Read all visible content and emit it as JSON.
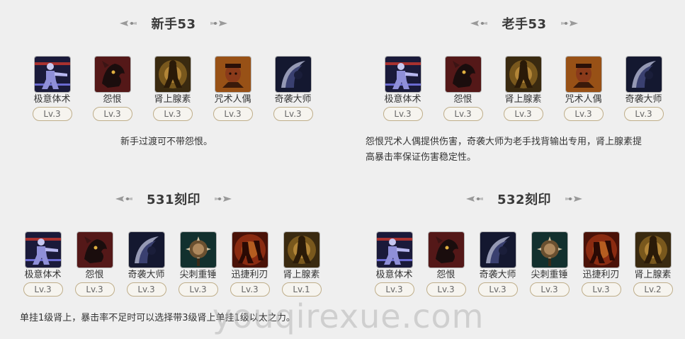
{
  "sections": {
    "newbie": {
      "title": "新手53",
      "skills": [
        {
          "name": "极意体术",
          "level": "Lv.3",
          "icon": "martial-arts-icon"
        },
        {
          "name": "怨恨",
          "level": "Lv.3",
          "icon": "grudge-icon"
        },
        {
          "name": "肾上腺素",
          "level": "Lv.3",
          "icon": "adrenaline-icon"
        },
        {
          "name": "咒术人偶",
          "level": "Lv.3",
          "icon": "curse-doll-icon"
        },
        {
          "name": "奇袭大师",
          "level": "Lv.3",
          "icon": "ambush-master-icon"
        }
      ],
      "description": "新手过渡可不带怨恨。"
    },
    "veteran": {
      "title": "老手53",
      "skills": [
        {
          "name": "极意体术",
          "level": "Lv.3",
          "icon": "martial-arts-icon"
        },
        {
          "name": "怨恨",
          "level": "Lv.3",
          "icon": "grudge-icon"
        },
        {
          "name": "肾上腺素",
          "level": "Lv.3",
          "icon": "adrenaline-icon"
        },
        {
          "name": "咒术人偶",
          "level": "Lv.3",
          "icon": "curse-doll-icon"
        },
        {
          "name": "奇袭大师",
          "level": "Lv.3",
          "icon": "ambush-master-icon"
        }
      ],
      "description_line1": "怨恨咒术人偶提供伤害，奇袭大师为老手找背输出专用，肾上腺素提",
      "description_line2": "高暴击率保证伤害稳定性。"
    },
    "build531": {
      "title": "531刻印",
      "skills": [
        {
          "name": "极意体术",
          "level": "Lv.3",
          "icon": "martial-arts-icon"
        },
        {
          "name": "怨恨",
          "level": "Lv.3",
          "icon": "grudge-icon"
        },
        {
          "name": "奇袭大师",
          "level": "Lv.3",
          "icon": "ambush-master-icon"
        },
        {
          "name": "尖刺重锤",
          "level": "Lv.3",
          "icon": "spiked-hammer-icon"
        },
        {
          "name": "迅捷利刃",
          "level": "Lv.3",
          "icon": "swift-blade-icon"
        },
        {
          "name": "肾上腺素",
          "level": "Lv.1",
          "icon": "adrenaline-icon"
        }
      ],
      "description": "单挂1级肾上，暴击率不足时可以选择带3级肾上单挂1级以太之力。"
    },
    "build532": {
      "title": "532刻印",
      "skills": [
        {
          "name": "极意体术",
          "level": "Lv.3",
          "icon": "martial-arts-icon"
        },
        {
          "name": "怨恨",
          "level": "Lv.3",
          "icon": "grudge-icon"
        },
        {
          "name": "奇袭大师",
          "level": "Lv.3",
          "icon": "ambush-master-icon"
        },
        {
          "name": "尖刺重锤",
          "level": "Lv.3",
          "icon": "spiked-hammer-icon"
        },
        {
          "name": "迅捷利刃",
          "level": "Lv.3",
          "icon": "swift-blade-icon"
        },
        {
          "name": "肾上腺素",
          "level": "Lv.2",
          "icon": "adrenaline-icon"
        }
      ]
    }
  },
  "watermark": "youqirexue.com",
  "colors": {
    "background": "#efefef",
    "badge_border": "#bfae8a",
    "title": "#3a3a3a"
  }
}
